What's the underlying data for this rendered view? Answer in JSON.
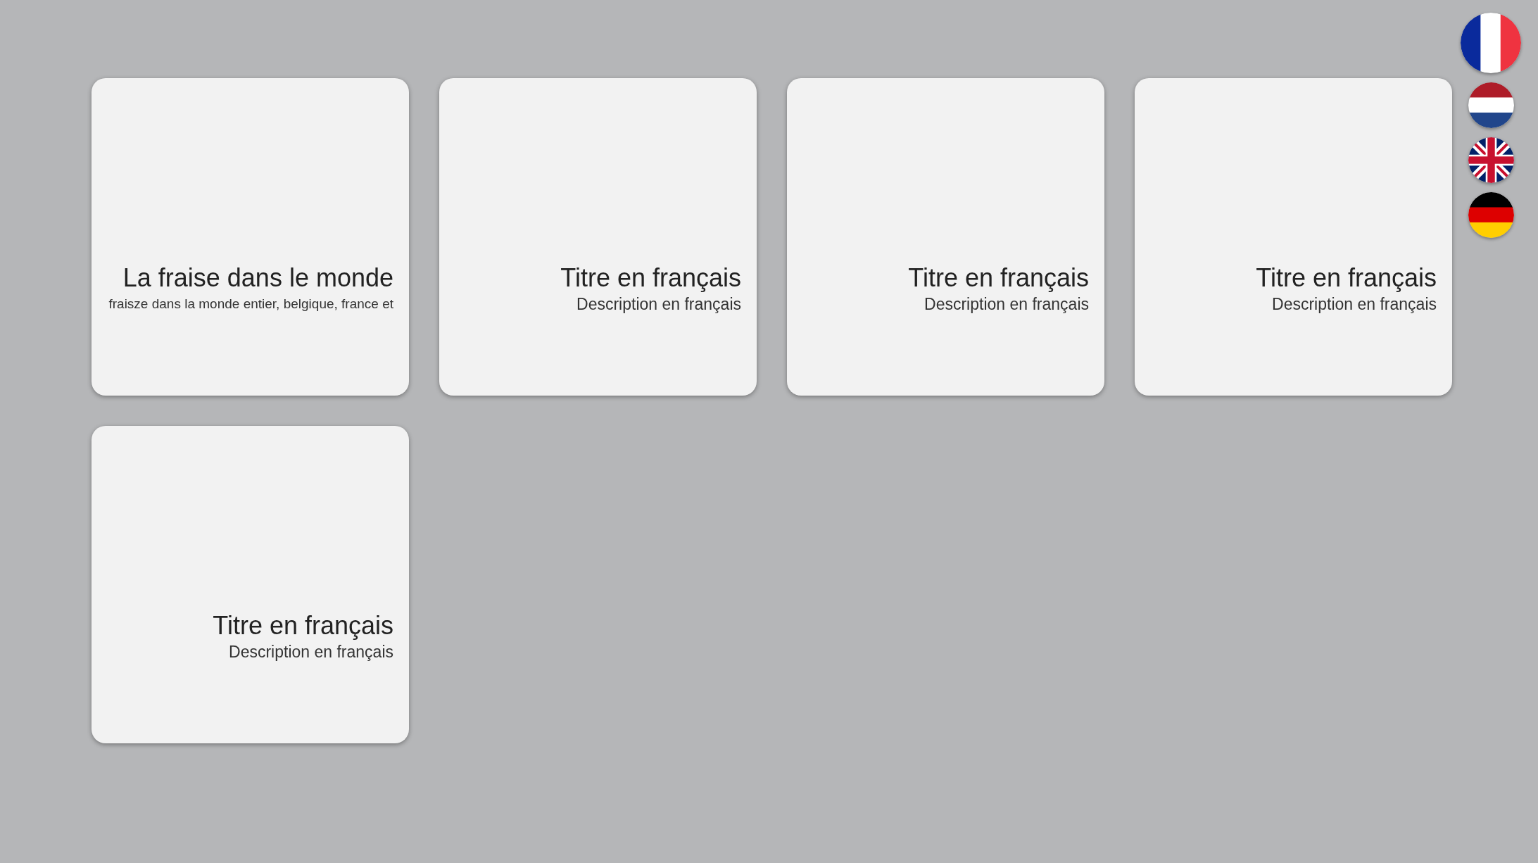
{
  "cards": [
    {
      "title": "La fraise dans le monde",
      "description": "fraisze dans la monde entier, belgique, france et"
    },
    {
      "title": "Titre en français",
      "description": "Description en français"
    },
    {
      "title": "Titre en français",
      "description": "Description en français"
    },
    {
      "title": "Titre en français",
      "description": "Description en français"
    },
    {
      "title": "Titre en français",
      "description": "Description en français"
    }
  ],
  "languages": [
    {
      "kind": "fr",
      "selected": true
    },
    {
      "kind": "nl",
      "selected": false
    },
    {
      "kind": "en",
      "selected": false
    },
    {
      "kind": "de",
      "selected": false
    }
  ]
}
